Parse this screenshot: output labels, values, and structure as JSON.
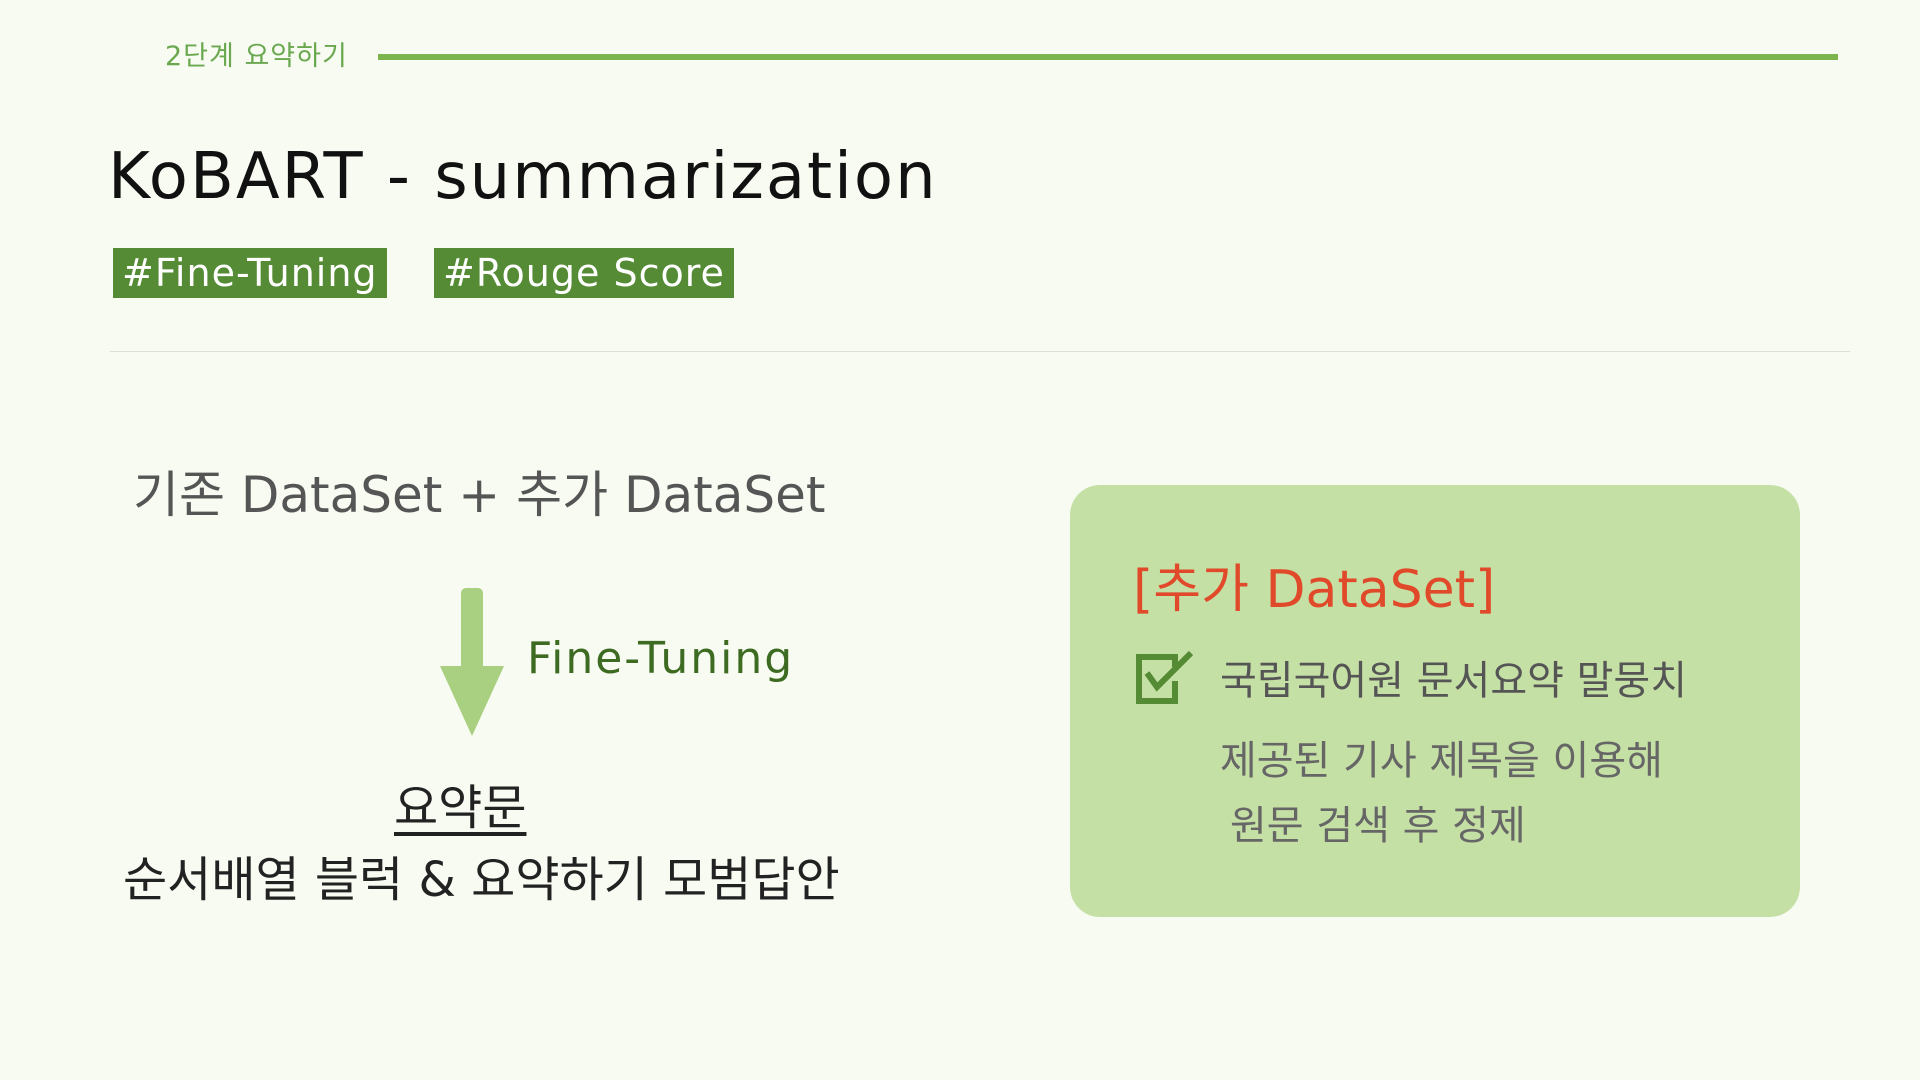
{
  "header": {
    "section": "2단계 요약하기"
  },
  "title": "KoBART - summarization",
  "tags": [
    "#Fine-Tuning",
    "#Rouge Score"
  ],
  "flow": {
    "input": "기존 DataSet + 추가 DataSet",
    "step": "Fine-Tuning",
    "output_title": "요약문",
    "output_desc": "순서배열 블럭 & 요약하기 모범답안"
  },
  "card": {
    "title": "[추가 DataSet]",
    "item": "국립국어원 문서요약 말뭉치",
    "desc_line1": "제공된 기사 제목을 이용해",
    "desc_line2": "원문 검색 후 정제",
    "icon": "checkbox-checked-icon"
  },
  "colors": {
    "accent": "#7cb450",
    "tag_bg": "#558b35",
    "card_bg": "#c5e0a5",
    "card_title": "#e04a2a",
    "arrow": "#a8d080"
  }
}
